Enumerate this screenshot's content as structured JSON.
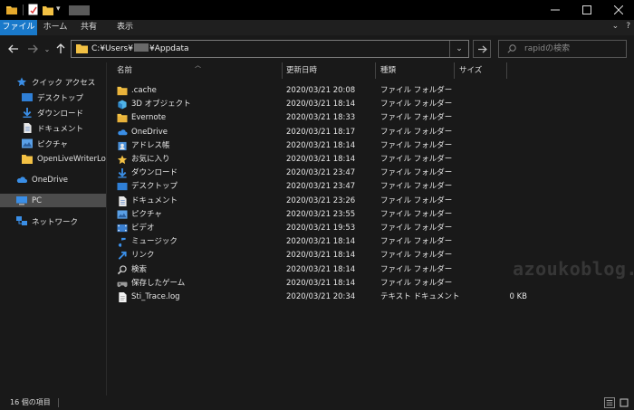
{
  "ribbon": {
    "tabs": [
      {
        "label": "ファイル",
        "active": true
      },
      {
        "label": "ホーム",
        "active": false
      },
      {
        "label": "共有",
        "active": false
      },
      {
        "label": "表示",
        "active": false
      }
    ]
  },
  "address": {
    "prefix": "C:¥Users¥",
    "suffix": "¥Appdata"
  },
  "search": {
    "placeholder": "rapidの検索"
  },
  "sidebar": {
    "items": [
      {
        "label": "クイック アクセス",
        "icon": "star-icon",
        "pinned": false
      },
      {
        "label": "デスクトップ",
        "icon": "desktop-icon",
        "pinned": true
      },
      {
        "label": "ダウンロード",
        "icon": "download-icon",
        "pinned": true
      },
      {
        "label": "ドキュメント",
        "icon": "document-icon",
        "pinned": true
      },
      {
        "label": "ピクチャ",
        "icon": "pictures-icon",
        "pinned": true
      },
      {
        "label": "OpenLiveWriterLoca",
        "icon": "folder-icon",
        "pinned": false
      },
      {
        "label": "OneDrive",
        "icon": "cloud-icon",
        "pinned": false
      },
      {
        "label": "PC",
        "icon": "pc-icon",
        "pinned": false,
        "selected": true
      },
      {
        "label": "ネットワーク",
        "icon": "network-icon",
        "pinned": false
      }
    ]
  },
  "columns": {
    "name": "名前",
    "date": "更新日時",
    "type": "種類",
    "size": "サイズ"
  },
  "files": [
    {
      "name": ".cache",
      "date": "2020/03/21 20:08",
      "type": "ファイル フォルダー",
      "size": "",
      "icon": "folder-icon"
    },
    {
      "name": "3D オブジェクト",
      "date": "2020/03/21 18:14",
      "type": "ファイル フォルダー",
      "size": "",
      "icon": "3d-objects-icon"
    },
    {
      "name": "Evernote",
      "date": "2020/03/21 18:33",
      "type": "ファイル フォルダー",
      "size": "",
      "icon": "folder-icon"
    },
    {
      "name": "OneDrive",
      "date": "2020/03/21 18:17",
      "type": "ファイル フォルダー",
      "size": "",
      "icon": "cloud-icon"
    },
    {
      "name": "アドレス帳",
      "date": "2020/03/21 18:14",
      "type": "ファイル フォルダー",
      "size": "",
      "icon": "contacts-icon"
    },
    {
      "name": "お気に入り",
      "date": "2020/03/21 18:14",
      "type": "ファイル フォルダー",
      "size": "",
      "icon": "star-icon"
    },
    {
      "name": "ダウンロード",
      "date": "2020/03/21 23:47",
      "type": "ファイル フォルダー",
      "size": "",
      "icon": "download-icon"
    },
    {
      "name": "デスクトップ",
      "date": "2020/03/21 23:47",
      "type": "ファイル フォルダー",
      "size": "",
      "icon": "desktop-icon"
    },
    {
      "name": "ドキュメント",
      "date": "2020/03/21 23:26",
      "type": "ファイル フォルダー",
      "size": "",
      "icon": "document-icon"
    },
    {
      "name": "ピクチャ",
      "date": "2020/03/21 23:55",
      "type": "ファイル フォルダー",
      "size": "",
      "icon": "pictures-icon"
    },
    {
      "name": "ビデオ",
      "date": "2020/03/21 19:53",
      "type": "ファイル フォルダー",
      "size": "",
      "icon": "video-icon"
    },
    {
      "name": "ミュージック",
      "date": "2020/03/21 18:14",
      "type": "ファイル フォルダー",
      "size": "",
      "icon": "music-icon"
    },
    {
      "name": "リンク",
      "date": "2020/03/21 18:14",
      "type": "ファイル フォルダー",
      "size": "",
      "icon": "link-icon"
    },
    {
      "name": "検索",
      "date": "2020/03/21 18:14",
      "type": "ファイル フォルダー",
      "size": "",
      "icon": "search-icon"
    },
    {
      "name": "保存したゲーム",
      "date": "2020/03/21 18:14",
      "type": "ファイル フォルダー",
      "size": "",
      "icon": "saved-games-icon"
    },
    {
      "name": "Sti_Trace.log",
      "date": "2020/03/21 20:34",
      "type": "テキスト ドキュメント",
      "size": "0 KB",
      "icon": "text-file-icon"
    }
  ],
  "watermark": "azoukoblog.com",
  "status": {
    "item_count": "16 個の項目"
  },
  "colors": {
    "accent": "#1979ca",
    "folder": "#f3c144",
    "background": "#191919"
  }
}
